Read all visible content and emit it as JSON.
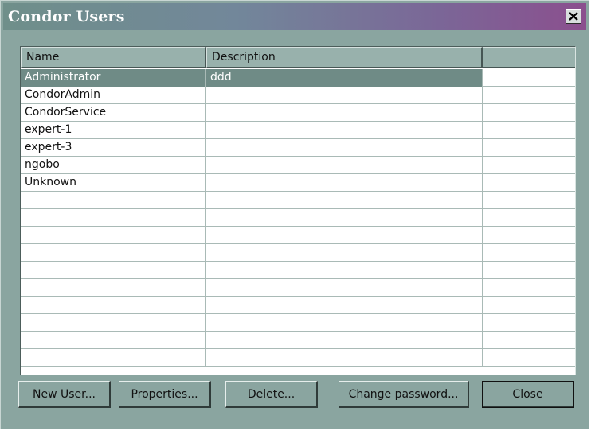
{
  "window": {
    "title": "Condor Users",
    "close_icon": "close-icon"
  },
  "table": {
    "columns": [
      "Name",
      "Description",
      ""
    ],
    "rows": [
      {
        "name": "Administrator",
        "description": "ddd"
      },
      {
        "name": "CondorAdmin",
        "description": ""
      },
      {
        "name": "CondorService",
        "description": ""
      },
      {
        "name": "expert-1",
        "description": ""
      },
      {
        "name": "expert-3",
        "description": ""
      },
      {
        "name": "ngobo",
        "description": ""
      },
      {
        "name": "Unknown",
        "description": ""
      }
    ],
    "selected_row": 0
  },
  "buttons": {
    "new_user": "New User...",
    "properties": "Properties...",
    "delete": "Delete...",
    "change_password": "Change password...",
    "close": "Close"
  },
  "colors": {
    "window_bg": "#8aa5a0",
    "selection": "#6f8b86"
  }
}
